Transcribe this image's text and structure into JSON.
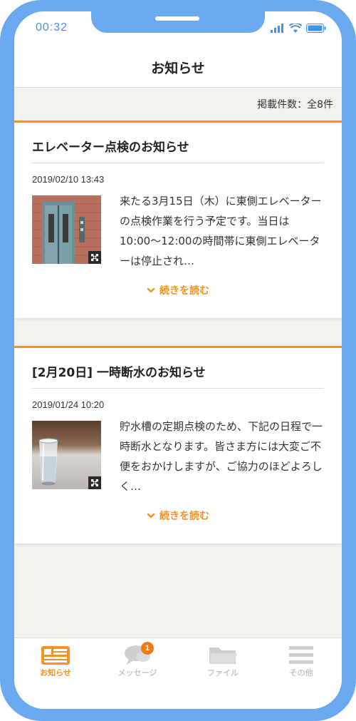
{
  "status_bar": {
    "time": "00:32"
  },
  "header": {
    "title": "お知らせ"
  },
  "count": {
    "text": "掲載件数：全8件"
  },
  "notices": [
    {
      "title": "エレベーター点検のお知らせ",
      "date": "2019/02/10 13:43",
      "body": "来たる3月15日（木）に東側エレベーターの点検作業を行う予定です。当日は10:00〜12:00の時間帯に東側エレベーターは停止され…",
      "read_more": "続きを読む",
      "image": "elevator-photo"
    },
    {
      "title": "[2月20日] 一時断水のお知らせ",
      "date": "2019/01/24 10:20",
      "body": "貯水槽の定期点検のため、下記の日程で一時断水となります。皆さま方には大変ご不便をおかけしますが、ご協力のほどよろしく…",
      "read_more": "続きを読む",
      "image": "water-glass-photo"
    }
  ],
  "tabbar": {
    "tabs": [
      {
        "label": "お知らせ",
        "icon": "news-icon",
        "active": true
      },
      {
        "label": "メッセージ",
        "icon": "chat-bubble-icon",
        "badge": "1"
      },
      {
        "label": "ファイル",
        "icon": "folder-icon"
      },
      {
        "label": "その他",
        "icon": "menu-icon"
      }
    ]
  },
  "colors": {
    "accent": "#f39323",
    "frame": "#6aa9f0",
    "background": "#f3f1ee"
  }
}
